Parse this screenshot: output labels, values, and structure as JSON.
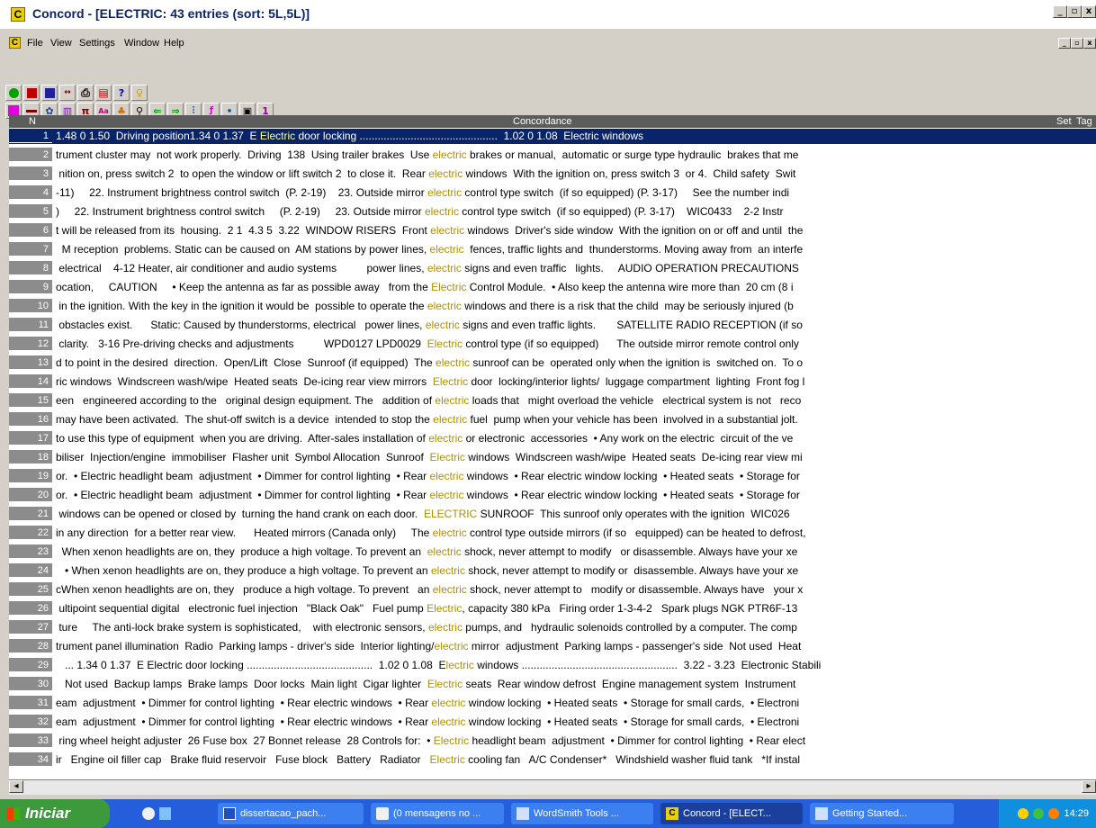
{
  "window": {
    "title": "Concord - [ELECTRIC: 43 entries (sort: 5L,5L)]"
  },
  "menu": [
    "File",
    "View",
    "Settings",
    "Window",
    "Help"
  ],
  "grid": {
    "headers": {
      "n": "N",
      "concordance": "Concordance",
      "set": "Set",
      "tag": "Tag"
    },
    "selected_row": 0,
    "rows": [
      {
        "n": "1",
        "left": "1.48 0 1.50  Driving position",
        "mid": "1.34 0 1.37  E ",
        "kw": "Electric",
        "right": " door locking ..............................................  1.02 0 1.08  Electric windows"
      },
      {
        "n": "2",
        "left": "trument cluster may  not work properly.  Driving  138  Using trailer brakes  Use ",
        "kw": "electric",
        "right": " brakes or manual,  automatic or surge type hydraulic  brakes that me"
      },
      {
        "n": "3",
        "left": " nition on, press switch 2  to open the window or lift switch 2  to close it.  Rear ",
        "kw": "electric",
        "right": " windows  With the ignition on, press switch 3  or 4.  Child safety  Swit"
      },
      {
        "n": "4",
        "left": "-11)     22. Instrument brightness control switch  (P. 2-19)    23. Outside mirror ",
        "kw": "electric",
        "right": " control type switch  (if so equipped) (P. 3-17)     See the number indi"
      },
      {
        "n": "5",
        "left": ")     22. Instrument brightness control switch     (P. 2-19)     23. Outside mirror ",
        "kw": "electric",
        "right": " control type switch  (if so equipped) (P. 3-17)    WIC0433    2-2 Instr"
      },
      {
        "n": "6",
        "left": "t will be released from its  housing.  2 1  4.3 5  3.22  WINDOW RISERS  Front ",
        "kw": "electric",
        "right": " windows  Driver's side window  With the ignition on or off and until  the"
      },
      {
        "n": "7",
        "left": "  M reception  problems. Static can be caused on  AM stations by power lines, ",
        "kw": "electric",
        "right": "  fences, traffic lights and  thunderstorms. Moving away from  an interfe"
      },
      {
        "n": "8",
        "left": " electrical    4-12 Heater, air conditioner and audio systems          power lines, ",
        "kw": "electric",
        "right": " signs and even traffic   lights.     AUDIO OPERATION PRECAUTIONS"
      },
      {
        "n": "9",
        "left": "ocation,     CAUTION     • Keep the antenna as far as possible away   from the ",
        "kw": "Electric",
        "right": " Control Module.  • Also keep the antenna wire more than  20 cm (8 i"
      },
      {
        "n": "10",
        "left": " in the ignition. With the key in the ignition it would be  possible to operate the ",
        "kw": "electric",
        "right": " windows and there is a risk that the child  may be seriously injured (b"
      },
      {
        "n": "11",
        "left": " obstacles exist.      Static: Caused by thunderstorms, electrical   power lines, ",
        "kw": "electric",
        "right": " signs and even traffic lights.       SATELLITE RADIO RECEPTION (if so"
      },
      {
        "n": "12",
        "left": " clarity.   3-16 Pre-driving checks and adjustments          WPD0127 LPD0029  ",
        "kw": "Electric",
        "right": " control type (if so equipped)      The outside mirror remote control only"
      },
      {
        "n": "13",
        "left": "d to point in the desired  direction.  Open/Lift  Close  Sunroof (if equipped)  The ",
        "kw": "electric",
        "right": " sunroof can be  operated only when the ignition is  switched on.  To o"
      },
      {
        "n": "14",
        "left": "ric windows  Windscreen wash/wipe  Heated seats  De-icing rear view mirrors  ",
        "kw": "Electric",
        "right": " door  locking/interior lights/  luggage compartment  lighting  Front fog l"
      },
      {
        "n": "15",
        "left": "een   engineered according to the   original design equipment. The   addition of ",
        "kw": "electric",
        "right": " loads that   might overload the vehicle   electrical system is not   reco"
      },
      {
        "n": "16",
        "left": "may have been activated.  The shut-off switch is a device  intended to stop the ",
        "kw": "electric",
        "right": " fuel  pump when your vehicle has been  involved in a substantial jolt."
      },
      {
        "n": "17",
        "left": "to use this type of equipment  when you are driving.  After-sales installation of ",
        "kw": "electric",
        "right": " or electronic  accessories  • Any work on the electric  circuit of the ve"
      },
      {
        "n": "18",
        "left": "biliser  Injection/engine  immobiliser  Flasher unit  Symbol Allocation  Sunroof  ",
        "kw": "Electric",
        "right": " windows  Windscreen wash/wipe  Heated seats  De-icing rear view mi"
      },
      {
        "n": "19",
        "left": "or.  • Electric headlight beam  adjustment  • Dimmer for control lighting  • Rear ",
        "kw": "electric",
        "right": " windows  • Rear electric window locking  • Heated seats  • Storage for"
      },
      {
        "n": "20",
        "left": "or.  • Electric headlight beam  adjustment  • Dimmer for control lighting  • Rear ",
        "kw": "electric",
        "right": " windows  • Rear electric window locking  • Heated seats  • Storage for"
      },
      {
        "n": "21",
        "left": " windows can be opened or closed by  turning the hand crank on each door.  ",
        "kw": "ELECTRIC",
        "right": " SUNROOF  This sunroof only operates with the ignition  WIC026"
      },
      {
        "n": "22",
        "left": "in any direction  for a better rear view.      Heated mirrors (Canada only)     The ",
        "kw": "electric",
        "right": " control type outside mirrors (if so   equipped) can be heated to defrost,"
      },
      {
        "n": "23",
        "left": "  When xenon headlights are on, they  produce a high voltage. To prevent an  ",
        "kw": "electric",
        "right": " shock, never attempt to modify   or disassemble. Always have your xe"
      },
      {
        "n": "24",
        "left": "   • When xenon headlights are on, they produce a high voltage. To prevent an ",
        "kw": "electric",
        "right": " shock, never attempt to modify or  disassemble. Always have your xe"
      },
      {
        "n": "25",
        "left": "cWhen xenon headlights are on, they   produce a high voltage. To prevent   an ",
        "kw": "electric",
        "right": " shock, never attempt to   modify or disassemble. Always have   your x"
      },
      {
        "n": "26",
        "left": " ultipoint sequential digital   electronic fuel injection   \"Black Oak\"   Fuel pump ",
        "kw": "Electric",
        "right": ", capacity 380 kPa   Firing order 1-3-4-2   Spark plugs NGK PTR6F-13"
      },
      {
        "n": "27",
        "left": " ture     The anti-lock brake system is sophisticated,    with electronic sensors, ",
        "kw": "electric",
        "right": " pumps, and   hydraulic solenoids controlled by a computer. The comp"
      },
      {
        "n": "28",
        "left": "trument panel illumination  Radio  Parking lamps - driver's side  Interior lighting/",
        "kw": "electric",
        "right": " mirror  adjustment  Parking lamps - passenger's side  Not used  Heat"
      },
      {
        "n": "29",
        "left": "   ... 1.34 0 1.37  E Electric door locking ..........................................  1.02 0 1.08  E",
        "kw": "lectric",
        "right": " windows ....................................................  3.22 - 3.23  Electronic Stabili"
      },
      {
        "n": "30",
        "left": "   Not used  Backup lamps  Brake lamps  Door locks  Main light  Cigar lighter  ",
        "kw": "Electric",
        "right": " seats  Rear window defrost  Engine management system  Instrument"
      },
      {
        "n": "31",
        "left": "eam  adjustment  • Dimmer for control lighting  • Rear electric windows  • Rear ",
        "kw": "electric",
        "right": " window locking  • Heated seats  • Storage for small cards,  • Electroni"
      },
      {
        "n": "32",
        "left": "eam  adjustment  • Dimmer for control lighting  • Rear electric windows  • Rear ",
        "kw": "electric",
        "right": " window locking  • Heated seats  • Storage for small cards,  • Electroni"
      },
      {
        "n": "33",
        "left": " ring wheel height adjuster  26 Fuse box  27 Bonnet release  28 Controls for:  • ",
        "kw": "Electric",
        "right": " headlight beam  adjustment  • Dimmer for control lighting  • Rear elect"
      },
      {
        "n": "34",
        "left": "ir   Engine oil filler cap   Brake fluid reservoir   Fuse block   Battery   Radiator   ",
        "kw": "Electric",
        "right": " cooling fan   A/C Condenser*   Windshield washer fluid tank   *If instal"
      }
    ]
  },
  "taskbar": {
    "start": "Iniciar",
    "tasks": [
      {
        "label": "dissertacao_pach..."
      },
      {
        "label": "(0 mensagens no ..."
      },
      {
        "label": "WordSmith Tools ..."
      },
      {
        "label": "Concord - [ELECT..."
      },
      {
        "label": "Getting Started..."
      }
    ],
    "clock": "14:29"
  }
}
